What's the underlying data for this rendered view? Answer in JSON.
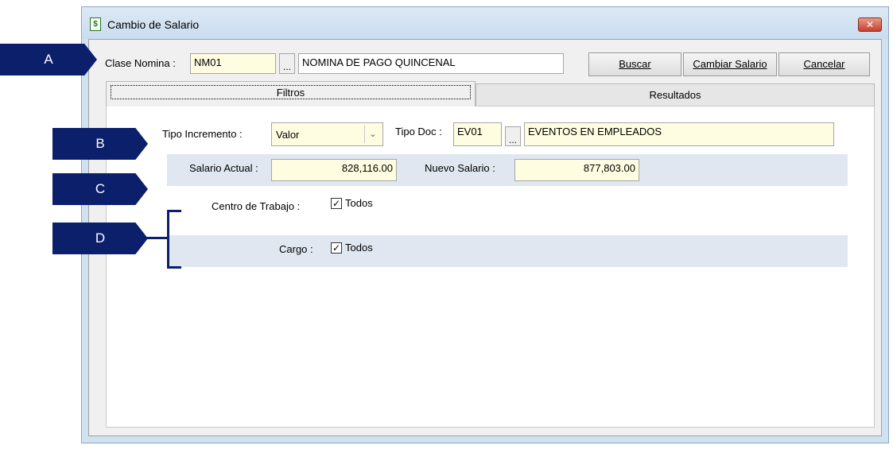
{
  "window": {
    "title": "Cambio de Salario",
    "close_label": "✕"
  },
  "clase_nomina": {
    "label": "Clase Nomina :",
    "code": "NM01",
    "lookup_label": "...",
    "description": "NOMINA DE PAGO QUINCENAL"
  },
  "buttons": {
    "buscar": "Buscar",
    "cambiar": "Cambiar Salario",
    "cancelar": "Cancelar"
  },
  "tabs": [
    {
      "label": "Filtros"
    },
    {
      "label": "Resultados"
    }
  ],
  "filtros": {
    "tipo_incremento_label": "Tipo Incremento :",
    "tipo_incremento_value": "Valor",
    "tipo_doc_label": "Tipo Doc :",
    "tipo_doc_code": "EV01",
    "tipo_doc_lookup": "...",
    "tipo_doc_desc": "EVENTOS EN EMPLEADOS",
    "salario_actual_label": "Salario Actual :",
    "salario_actual_value": "828,116.00",
    "nuevo_salario_label": "Nuevo Salario :",
    "nuevo_salario_value": "877,803.00",
    "centro_label": "Centro de Trabajo :",
    "centro_check": "Todos",
    "cargo_label": "Cargo :",
    "cargo_check": "Todos"
  },
  "callouts": [
    "A",
    "B",
    "C",
    "D"
  ],
  "colors": {
    "callout": "#0b1f6b",
    "yellow_field": "#fffde1",
    "band": "#e0e7f0"
  }
}
